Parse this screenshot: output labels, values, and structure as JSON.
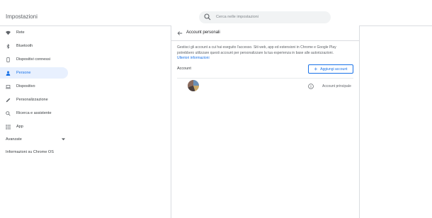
{
  "app": {
    "title": "Impostazioni"
  },
  "search": {
    "placeholder": "Cerca nelle impostazioni"
  },
  "sidebar": {
    "items": [
      {
        "label": "Rete",
        "icon": "wifi-icon"
      },
      {
        "label": "Bluetooth",
        "icon": "bluetooth-icon"
      },
      {
        "label": "Dispositivi connessi",
        "icon": "phone-icon"
      },
      {
        "label": "Persone",
        "icon": "person-icon",
        "active": true
      },
      {
        "label": "Dispositivo",
        "icon": "laptop-icon"
      },
      {
        "label": "Personalizzazione",
        "icon": "pen-icon"
      },
      {
        "label": "Ricerca e assistente",
        "icon": "search-icon"
      },
      {
        "label": "App",
        "icon": "apps-grid-icon"
      }
    ],
    "advanced_label": "Avanzate",
    "about_label": "Informazioni su Chrome OS"
  },
  "panel": {
    "title": "Account personali",
    "description": "Gestisci gli account a cui hai eseguito l'accesso. Siti web, app ed estensioni in Chrome e Google Play potrebbero utilizzare questi account per personalizzare la tua esperienza in base alle autorizzazioni.",
    "learn_more": "Ulteriori informazioni",
    "section_label": "Account",
    "add_account_label": "Aggiungi account",
    "accounts": [
      {
        "primary_label": "Account principale"
      }
    ]
  },
  "colors": {
    "accent": "#1a73e8",
    "active_bg": "#e8f0fe",
    "divider": "#dadce0"
  }
}
